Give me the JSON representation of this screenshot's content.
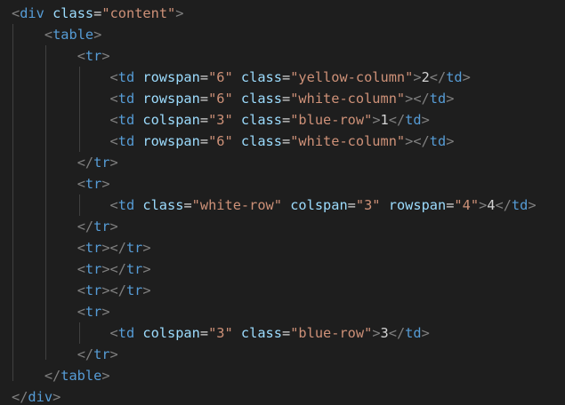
{
  "editor": {
    "theme": "dark",
    "colors": {
      "background": "#1e1e1e",
      "punctuation": "#808080",
      "tag": "#569cd6",
      "attribute": "#9cdcfe",
      "string": "#ce9178",
      "text": "#d4d4d4",
      "indent_guide": "#404040"
    },
    "lines": [
      [
        {
          "t": "punct",
          "v": "<"
        },
        {
          "t": "tag",
          "v": "div"
        },
        {
          "t": "text",
          "v": " "
        },
        {
          "t": "attr",
          "v": "class"
        },
        {
          "t": "text",
          "v": "="
        },
        {
          "t": "str",
          "v": "\"content\""
        },
        {
          "t": "punct",
          "v": ">"
        }
      ],
      [
        {
          "t": "text",
          "v": "    "
        },
        {
          "t": "punct",
          "v": "<"
        },
        {
          "t": "tag",
          "v": "table"
        },
        {
          "t": "punct",
          "v": ">"
        }
      ],
      [
        {
          "t": "text",
          "v": "        "
        },
        {
          "t": "punct",
          "v": "<"
        },
        {
          "t": "tag",
          "v": "tr"
        },
        {
          "t": "punct",
          "v": ">"
        }
      ],
      [
        {
          "t": "text",
          "v": "            "
        },
        {
          "t": "punct",
          "v": "<"
        },
        {
          "t": "tag",
          "v": "td"
        },
        {
          "t": "text",
          "v": " "
        },
        {
          "t": "attr",
          "v": "rowspan"
        },
        {
          "t": "text",
          "v": "="
        },
        {
          "t": "str",
          "v": "\"6\""
        },
        {
          "t": "text",
          "v": " "
        },
        {
          "t": "attr",
          "v": "class"
        },
        {
          "t": "text",
          "v": "="
        },
        {
          "t": "str",
          "v": "\"yellow-column\""
        },
        {
          "t": "punct",
          "v": ">"
        },
        {
          "t": "text",
          "v": "2"
        },
        {
          "t": "punct",
          "v": "</"
        },
        {
          "t": "tag",
          "v": "td"
        },
        {
          "t": "punct",
          "v": ">"
        }
      ],
      [
        {
          "t": "text",
          "v": "            "
        },
        {
          "t": "punct",
          "v": "<"
        },
        {
          "t": "tag",
          "v": "td"
        },
        {
          "t": "text",
          "v": " "
        },
        {
          "t": "attr",
          "v": "rowspan"
        },
        {
          "t": "text",
          "v": "="
        },
        {
          "t": "str",
          "v": "\"6\""
        },
        {
          "t": "text",
          "v": " "
        },
        {
          "t": "attr",
          "v": "class"
        },
        {
          "t": "text",
          "v": "="
        },
        {
          "t": "str",
          "v": "\"white-column\""
        },
        {
          "t": "punct",
          "v": "></"
        },
        {
          "t": "tag",
          "v": "td"
        },
        {
          "t": "punct",
          "v": ">"
        }
      ],
      [
        {
          "t": "text",
          "v": "            "
        },
        {
          "t": "punct",
          "v": "<"
        },
        {
          "t": "tag",
          "v": "td"
        },
        {
          "t": "text",
          "v": " "
        },
        {
          "t": "attr",
          "v": "colspan"
        },
        {
          "t": "text",
          "v": "="
        },
        {
          "t": "str",
          "v": "\"3\""
        },
        {
          "t": "text",
          "v": " "
        },
        {
          "t": "attr",
          "v": "class"
        },
        {
          "t": "text",
          "v": "="
        },
        {
          "t": "str",
          "v": "\"blue-row\""
        },
        {
          "t": "punct",
          "v": ">"
        },
        {
          "t": "text",
          "v": "1"
        },
        {
          "t": "punct",
          "v": "</"
        },
        {
          "t": "tag",
          "v": "td"
        },
        {
          "t": "punct",
          "v": ">"
        }
      ],
      [
        {
          "t": "text",
          "v": "            "
        },
        {
          "t": "punct",
          "v": "<"
        },
        {
          "t": "tag",
          "v": "td"
        },
        {
          "t": "text",
          "v": " "
        },
        {
          "t": "attr",
          "v": "rowspan"
        },
        {
          "t": "text",
          "v": "="
        },
        {
          "t": "str",
          "v": "\"6\""
        },
        {
          "t": "text",
          "v": " "
        },
        {
          "t": "attr",
          "v": "class"
        },
        {
          "t": "text",
          "v": "="
        },
        {
          "t": "str",
          "v": "\"white-column\""
        },
        {
          "t": "punct",
          "v": "></"
        },
        {
          "t": "tag",
          "v": "td"
        },
        {
          "t": "punct",
          "v": ">"
        }
      ],
      [
        {
          "t": "text",
          "v": "        "
        },
        {
          "t": "punct",
          "v": "</"
        },
        {
          "t": "tag",
          "v": "tr"
        },
        {
          "t": "punct",
          "v": ">"
        }
      ],
      [
        {
          "t": "text",
          "v": "        "
        },
        {
          "t": "punct",
          "v": "<"
        },
        {
          "t": "tag",
          "v": "tr"
        },
        {
          "t": "punct",
          "v": ">"
        }
      ],
      [
        {
          "t": "text",
          "v": "            "
        },
        {
          "t": "punct",
          "v": "<"
        },
        {
          "t": "tag",
          "v": "td"
        },
        {
          "t": "text",
          "v": " "
        },
        {
          "t": "attr",
          "v": "class"
        },
        {
          "t": "text",
          "v": "="
        },
        {
          "t": "str",
          "v": "\"white-row\""
        },
        {
          "t": "text",
          "v": " "
        },
        {
          "t": "attr",
          "v": "colspan"
        },
        {
          "t": "text",
          "v": "="
        },
        {
          "t": "str",
          "v": "\"3\""
        },
        {
          "t": "text",
          "v": " "
        },
        {
          "t": "attr",
          "v": "rowspan"
        },
        {
          "t": "text",
          "v": "="
        },
        {
          "t": "str",
          "v": "\"4\""
        },
        {
          "t": "punct",
          "v": ">"
        },
        {
          "t": "text",
          "v": "4"
        },
        {
          "t": "punct",
          "v": "</"
        },
        {
          "t": "tag",
          "v": "td"
        },
        {
          "t": "punct",
          "v": ">"
        }
      ],
      [
        {
          "t": "text",
          "v": "        "
        },
        {
          "t": "punct",
          "v": "</"
        },
        {
          "t": "tag",
          "v": "tr"
        },
        {
          "t": "punct",
          "v": ">"
        }
      ],
      [
        {
          "t": "text",
          "v": "        "
        },
        {
          "t": "punct",
          "v": "<"
        },
        {
          "t": "tag",
          "v": "tr"
        },
        {
          "t": "punct",
          "v": "></"
        },
        {
          "t": "tag",
          "v": "tr"
        },
        {
          "t": "punct",
          "v": ">"
        }
      ],
      [
        {
          "t": "text",
          "v": "        "
        },
        {
          "t": "punct",
          "v": "<"
        },
        {
          "t": "tag",
          "v": "tr"
        },
        {
          "t": "punct",
          "v": "></"
        },
        {
          "t": "tag",
          "v": "tr"
        },
        {
          "t": "punct",
          "v": ">"
        }
      ],
      [
        {
          "t": "text",
          "v": "        "
        },
        {
          "t": "punct",
          "v": "<"
        },
        {
          "t": "tag",
          "v": "tr"
        },
        {
          "t": "punct",
          "v": "></"
        },
        {
          "t": "tag",
          "v": "tr"
        },
        {
          "t": "punct",
          "v": ">"
        }
      ],
      [
        {
          "t": "text",
          "v": "        "
        },
        {
          "t": "punct",
          "v": "<"
        },
        {
          "t": "tag",
          "v": "tr"
        },
        {
          "t": "punct",
          "v": ">"
        }
      ],
      [
        {
          "t": "text",
          "v": "            "
        },
        {
          "t": "punct",
          "v": "<"
        },
        {
          "t": "tag",
          "v": "td"
        },
        {
          "t": "text",
          "v": " "
        },
        {
          "t": "attr",
          "v": "colspan"
        },
        {
          "t": "text",
          "v": "="
        },
        {
          "t": "str",
          "v": "\"3\""
        },
        {
          "t": "text",
          "v": " "
        },
        {
          "t": "attr",
          "v": "class"
        },
        {
          "t": "text",
          "v": "="
        },
        {
          "t": "str",
          "v": "\"blue-row\""
        },
        {
          "t": "punct",
          "v": ">"
        },
        {
          "t": "text",
          "v": "3"
        },
        {
          "t": "punct",
          "v": "</"
        },
        {
          "t": "tag",
          "v": "td"
        },
        {
          "t": "punct",
          "v": ">"
        }
      ],
      [
        {
          "t": "text",
          "v": "        "
        },
        {
          "t": "punct",
          "v": "</"
        },
        {
          "t": "tag",
          "v": "tr"
        },
        {
          "t": "punct",
          "v": ">"
        }
      ],
      [
        {
          "t": "text",
          "v": "    "
        },
        {
          "t": "punct",
          "v": "</"
        },
        {
          "t": "tag",
          "v": "table"
        },
        {
          "t": "punct",
          "v": ">"
        }
      ],
      [
        {
          "t": "punct",
          "v": "</"
        },
        {
          "t": "tag",
          "v": "div"
        },
        {
          "t": "punct",
          "v": ">"
        }
      ]
    ]
  }
}
